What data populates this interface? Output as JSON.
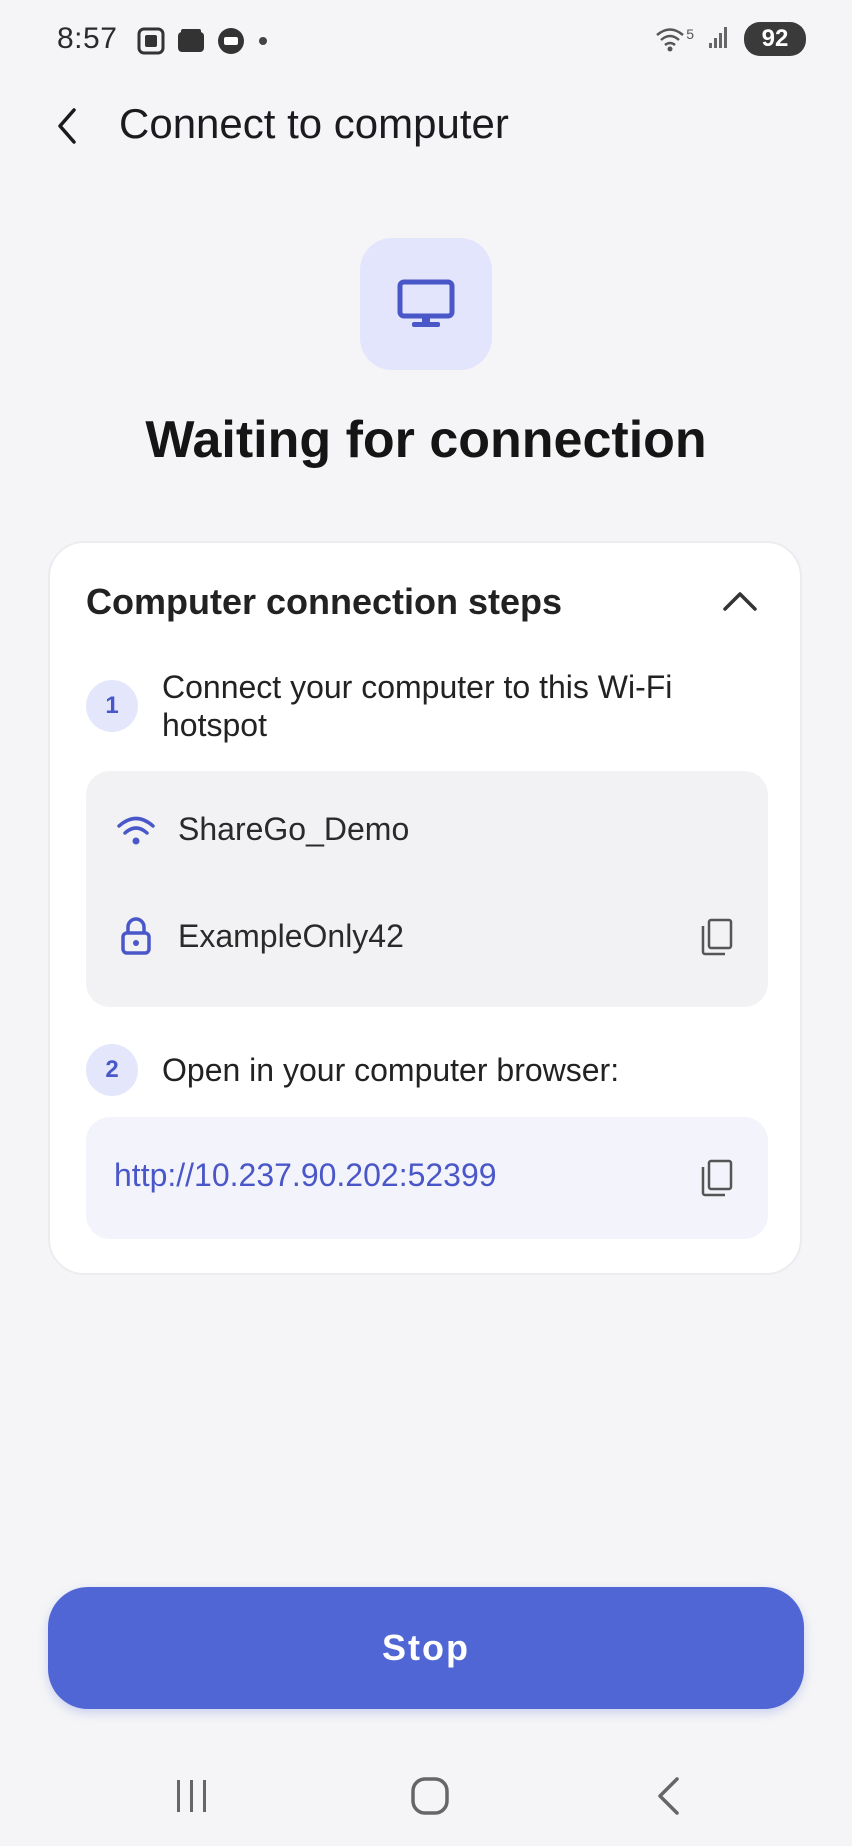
{
  "status_bar": {
    "time": "8:57",
    "wifi_label": "5",
    "battery": "92",
    "left_icons": [
      "scan-icon",
      "wallet-icon",
      "chat-icon",
      "dot-icon"
    ],
    "right_icons": [
      "wifi-icon",
      "signal-icon",
      "battery-icon"
    ]
  },
  "app_bar": {
    "title": "Connect to computer"
  },
  "hero": {
    "icon": "monitor-icon",
    "title": "Waiting for connection"
  },
  "card": {
    "title": "Computer connection steps",
    "steps": [
      {
        "number": "1",
        "text": "Connect your computer to this Wi-Fi hotspot"
      },
      {
        "number": "2",
        "text": "Open in your computer browser:"
      }
    ],
    "hotspot": {
      "ssid": "ShareGo_Demo",
      "password": "ExampleOnly42"
    },
    "url": "http://10.237.90.202:52399"
  },
  "actions": {
    "stop_label": "Stop"
  },
  "colors": {
    "accent": "#5066d4",
    "accent_text": "#4a57c8",
    "badge_bg": "#e4e7fb",
    "background": "#f5f5f7"
  }
}
